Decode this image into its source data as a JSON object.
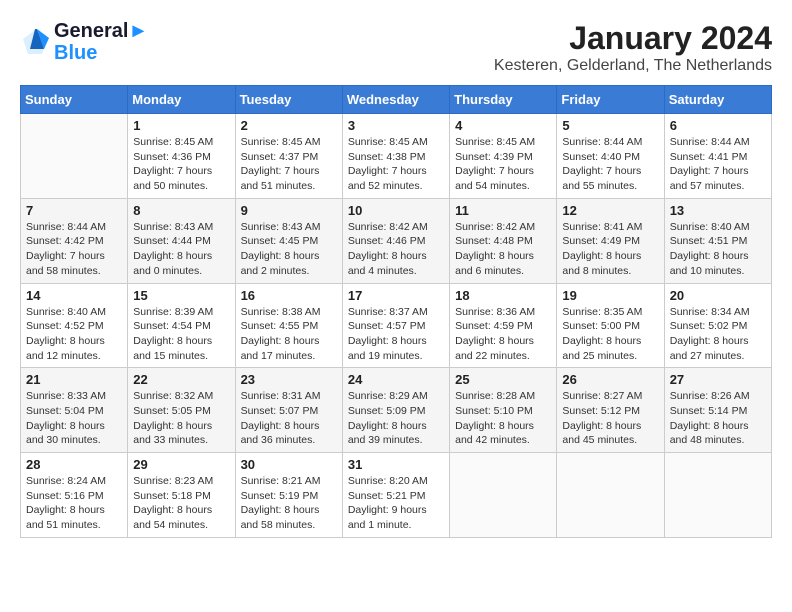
{
  "header": {
    "logo_line1": "General",
    "logo_line2": "Blue",
    "month": "January 2024",
    "location": "Kesteren, Gelderland, The Netherlands"
  },
  "days_of_week": [
    "Sunday",
    "Monday",
    "Tuesday",
    "Wednesday",
    "Thursday",
    "Friday",
    "Saturday"
  ],
  "weeks": [
    [
      {
        "num": "",
        "sunrise": "",
        "sunset": "",
        "daylight": ""
      },
      {
        "num": "1",
        "sunrise": "Sunrise: 8:45 AM",
        "sunset": "Sunset: 4:36 PM",
        "daylight": "Daylight: 7 hours and 50 minutes."
      },
      {
        "num": "2",
        "sunrise": "Sunrise: 8:45 AM",
        "sunset": "Sunset: 4:37 PM",
        "daylight": "Daylight: 7 hours and 51 minutes."
      },
      {
        "num": "3",
        "sunrise": "Sunrise: 8:45 AM",
        "sunset": "Sunset: 4:38 PM",
        "daylight": "Daylight: 7 hours and 52 minutes."
      },
      {
        "num": "4",
        "sunrise": "Sunrise: 8:45 AM",
        "sunset": "Sunset: 4:39 PM",
        "daylight": "Daylight: 7 hours and 54 minutes."
      },
      {
        "num": "5",
        "sunrise": "Sunrise: 8:44 AM",
        "sunset": "Sunset: 4:40 PM",
        "daylight": "Daylight: 7 hours and 55 minutes."
      },
      {
        "num": "6",
        "sunrise": "Sunrise: 8:44 AM",
        "sunset": "Sunset: 4:41 PM",
        "daylight": "Daylight: 7 hours and 57 minutes."
      }
    ],
    [
      {
        "num": "7",
        "sunrise": "Sunrise: 8:44 AM",
        "sunset": "Sunset: 4:42 PM",
        "daylight": "Daylight: 7 hours and 58 minutes."
      },
      {
        "num": "8",
        "sunrise": "Sunrise: 8:43 AM",
        "sunset": "Sunset: 4:44 PM",
        "daylight": "Daylight: 8 hours and 0 minutes."
      },
      {
        "num": "9",
        "sunrise": "Sunrise: 8:43 AM",
        "sunset": "Sunset: 4:45 PM",
        "daylight": "Daylight: 8 hours and 2 minutes."
      },
      {
        "num": "10",
        "sunrise": "Sunrise: 8:42 AM",
        "sunset": "Sunset: 4:46 PM",
        "daylight": "Daylight: 8 hours and 4 minutes."
      },
      {
        "num": "11",
        "sunrise": "Sunrise: 8:42 AM",
        "sunset": "Sunset: 4:48 PM",
        "daylight": "Daylight: 8 hours and 6 minutes."
      },
      {
        "num": "12",
        "sunrise": "Sunrise: 8:41 AM",
        "sunset": "Sunset: 4:49 PM",
        "daylight": "Daylight: 8 hours and 8 minutes."
      },
      {
        "num": "13",
        "sunrise": "Sunrise: 8:40 AM",
        "sunset": "Sunset: 4:51 PM",
        "daylight": "Daylight: 8 hours and 10 minutes."
      }
    ],
    [
      {
        "num": "14",
        "sunrise": "Sunrise: 8:40 AM",
        "sunset": "Sunset: 4:52 PM",
        "daylight": "Daylight: 8 hours and 12 minutes."
      },
      {
        "num": "15",
        "sunrise": "Sunrise: 8:39 AM",
        "sunset": "Sunset: 4:54 PM",
        "daylight": "Daylight: 8 hours and 15 minutes."
      },
      {
        "num": "16",
        "sunrise": "Sunrise: 8:38 AM",
        "sunset": "Sunset: 4:55 PM",
        "daylight": "Daylight: 8 hours and 17 minutes."
      },
      {
        "num": "17",
        "sunrise": "Sunrise: 8:37 AM",
        "sunset": "Sunset: 4:57 PM",
        "daylight": "Daylight: 8 hours and 19 minutes."
      },
      {
        "num": "18",
        "sunrise": "Sunrise: 8:36 AM",
        "sunset": "Sunset: 4:59 PM",
        "daylight": "Daylight: 8 hours and 22 minutes."
      },
      {
        "num": "19",
        "sunrise": "Sunrise: 8:35 AM",
        "sunset": "Sunset: 5:00 PM",
        "daylight": "Daylight: 8 hours and 25 minutes."
      },
      {
        "num": "20",
        "sunrise": "Sunrise: 8:34 AM",
        "sunset": "Sunset: 5:02 PM",
        "daylight": "Daylight: 8 hours and 27 minutes."
      }
    ],
    [
      {
        "num": "21",
        "sunrise": "Sunrise: 8:33 AM",
        "sunset": "Sunset: 5:04 PM",
        "daylight": "Daylight: 8 hours and 30 minutes."
      },
      {
        "num": "22",
        "sunrise": "Sunrise: 8:32 AM",
        "sunset": "Sunset: 5:05 PM",
        "daylight": "Daylight: 8 hours and 33 minutes."
      },
      {
        "num": "23",
        "sunrise": "Sunrise: 8:31 AM",
        "sunset": "Sunset: 5:07 PM",
        "daylight": "Daylight: 8 hours and 36 minutes."
      },
      {
        "num": "24",
        "sunrise": "Sunrise: 8:29 AM",
        "sunset": "Sunset: 5:09 PM",
        "daylight": "Daylight: 8 hours and 39 minutes."
      },
      {
        "num": "25",
        "sunrise": "Sunrise: 8:28 AM",
        "sunset": "Sunset: 5:10 PM",
        "daylight": "Daylight: 8 hours and 42 minutes."
      },
      {
        "num": "26",
        "sunrise": "Sunrise: 8:27 AM",
        "sunset": "Sunset: 5:12 PM",
        "daylight": "Daylight: 8 hours and 45 minutes."
      },
      {
        "num": "27",
        "sunrise": "Sunrise: 8:26 AM",
        "sunset": "Sunset: 5:14 PM",
        "daylight": "Daylight: 8 hours and 48 minutes."
      }
    ],
    [
      {
        "num": "28",
        "sunrise": "Sunrise: 8:24 AM",
        "sunset": "Sunset: 5:16 PM",
        "daylight": "Daylight: 8 hours and 51 minutes."
      },
      {
        "num": "29",
        "sunrise": "Sunrise: 8:23 AM",
        "sunset": "Sunset: 5:18 PM",
        "daylight": "Daylight: 8 hours and 54 minutes."
      },
      {
        "num": "30",
        "sunrise": "Sunrise: 8:21 AM",
        "sunset": "Sunset: 5:19 PM",
        "daylight": "Daylight: 8 hours and 58 minutes."
      },
      {
        "num": "31",
        "sunrise": "Sunrise: 8:20 AM",
        "sunset": "Sunset: 5:21 PM",
        "daylight": "Daylight: 9 hours and 1 minute."
      },
      {
        "num": "",
        "sunrise": "",
        "sunset": "",
        "daylight": ""
      },
      {
        "num": "",
        "sunrise": "",
        "sunset": "",
        "daylight": ""
      },
      {
        "num": "",
        "sunrise": "",
        "sunset": "",
        "daylight": ""
      }
    ]
  ]
}
